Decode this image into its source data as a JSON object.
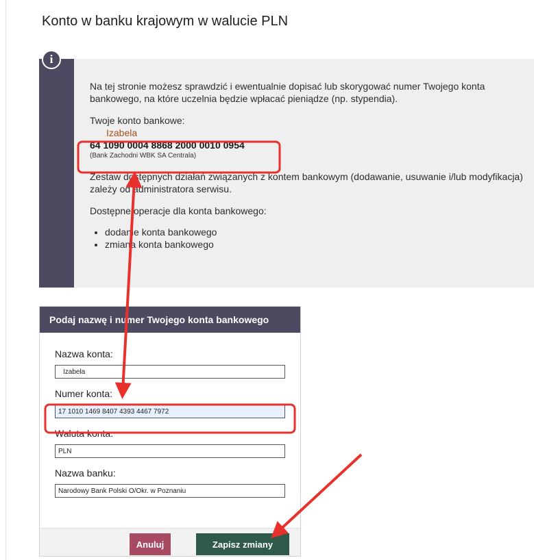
{
  "page": {
    "title": "Konto w banku krajowym w walucie PLN"
  },
  "info": {
    "intro": "Na tej stronie możesz sprawdzić i ewentualnie dopisać lub skorygować numer Twojego konta bankowego, na które uczelnia będzie wpłacać pieniądze (np. stypendia).",
    "account_heading": "Twoje konto bankowe:",
    "account_name": "Izabela",
    "account_number": "64 1090 0004 8868 2000 0010 0954",
    "bank_name": "(Bank Zachodni WBK SA Centrala)",
    "operations_info": "Zestaw dostępnych działań związanych z kontem bankowym (dodawanie, usuwanie i/lub modyfikacja) zależy od administratora serwisu.",
    "operations_heading": "Dostępne operacje dla konta bankowego:",
    "operations": [
      "dodanie konta bankowego",
      "zmiana konta bankowego"
    ]
  },
  "form": {
    "header": "Podaj nazwę i numer Twojego konta bankowego",
    "fields": {
      "account_name": {
        "label": "Nazwa konta:",
        "value": "Izabela"
      },
      "account_number": {
        "label": "Numer konta:",
        "value": "17 1010 1469 8407 4393 4467 7972"
      },
      "currency": {
        "label": "Waluta konta:",
        "value": "PLN"
      },
      "bank": {
        "label": "Nazwa banku:",
        "value": "Narodowy Bank Polski O/Okr. w Poznaniu"
      }
    },
    "buttons": {
      "cancel": "Anuluj",
      "save": "Zapisz zmiany"
    }
  },
  "colors": {
    "accent": "#4c4a60",
    "cancel": "#a84a62",
    "save": "#2f5a4a",
    "annotation": "#e8312c",
    "account_name": "#a8501c"
  }
}
